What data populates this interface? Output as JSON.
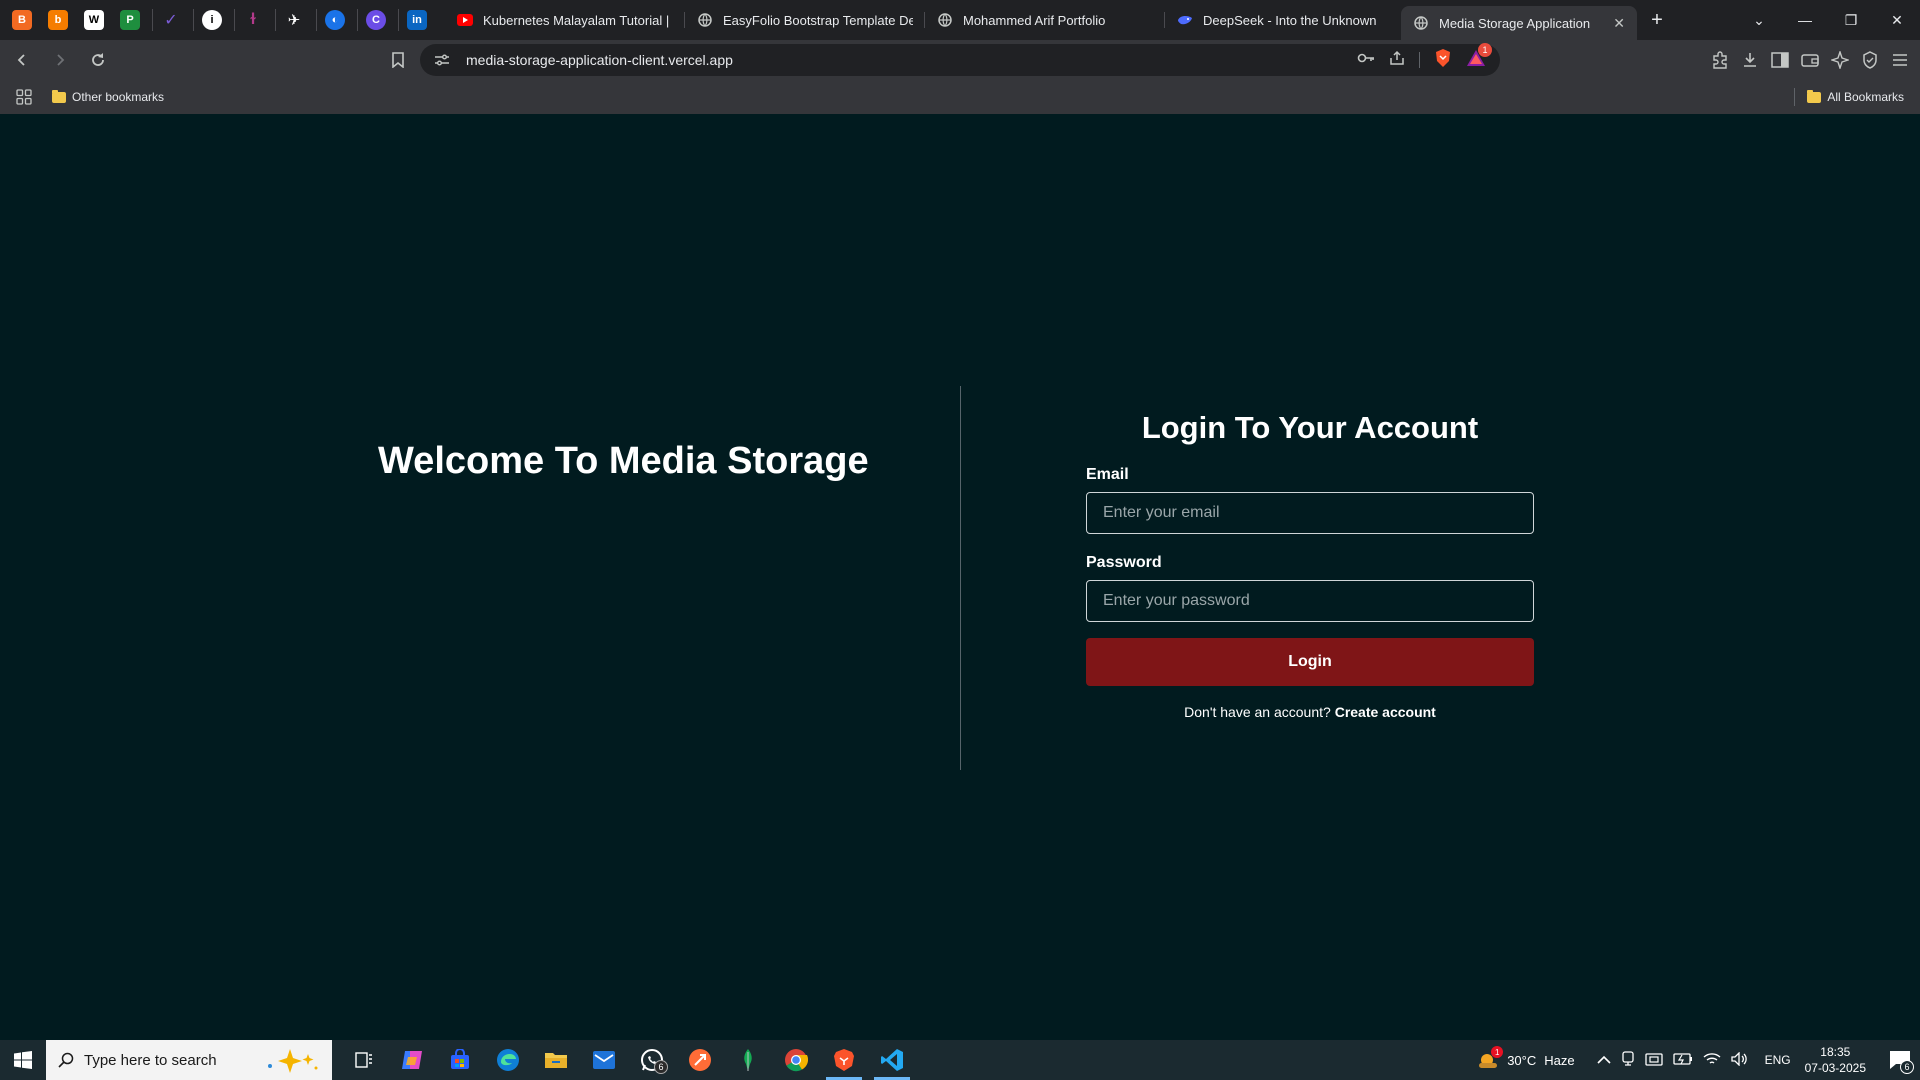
{
  "browser": {
    "pinned_tabs": [
      {
        "icon": "brave-shield-icon",
        "color": "#f26a22"
      },
      {
        "icon": "blogger-icon",
        "color": "#f57d00"
      },
      {
        "icon": "wordpress-w-icon",
        "color": "#ffffff"
      },
      {
        "icon": "ms-project-icon",
        "color": "#1e8e3e"
      },
      {
        "icon": "check-mark-icon",
        "color": "#7b5cd6"
      },
      {
        "icon": "info-icon",
        "color": "#ffffff"
      },
      {
        "icon": "tinder-like-icon",
        "color": "#b23a8a"
      },
      {
        "icon": "runner-icon",
        "color": "#ffffff"
      },
      {
        "icon": "globe-blue-icon",
        "color": "#1a73e8"
      },
      {
        "icon": "purple-c-icon",
        "color": "#6b4de6"
      },
      {
        "icon": "linkedin-icon",
        "color": "#0a66c2"
      }
    ],
    "tabs": [
      {
        "title": "Kubernetes Malayalam Tutorial | Pa",
        "favicon": "youtube-icon",
        "active": false
      },
      {
        "title": "EasyFolio Bootstrap Template Demo",
        "favicon": "globe-icon",
        "active": false
      },
      {
        "title": "Mohammed Arif Portfolio",
        "favicon": "globe-icon",
        "active": false
      },
      {
        "title": "DeepSeek - Into the Unknown",
        "favicon": "deepseek-whale-icon",
        "active": false
      },
      {
        "title": "Media Storage Application",
        "favicon": "globe-icon",
        "active": true
      }
    ],
    "address": "media-storage-application-client.vercel.app",
    "notification_count": "1",
    "bookmarks": {
      "left": "Other bookmarks",
      "right": "All Bookmarks"
    }
  },
  "page": {
    "welcome": "Welcome To Media Storage",
    "login_title": "Login To Your Account",
    "email_label": "Email",
    "email_placeholder": "Enter your email",
    "password_label": "Password",
    "password_placeholder": "Enter your password",
    "login_button": "Login",
    "signup_prompt": "Don't have an account?",
    "signup_link": "Create account",
    "colors": {
      "background": "#011b1f",
      "button": "#7f1517"
    }
  },
  "taskbar": {
    "search_placeholder": "Type here to search",
    "whatsapp_badge": "6",
    "weather_temp": "30°C",
    "weather_desc": "Haze",
    "weather_alert": "1",
    "language": "ENG",
    "time": "18:35",
    "date": "07-03-2025",
    "notifications": "6"
  }
}
